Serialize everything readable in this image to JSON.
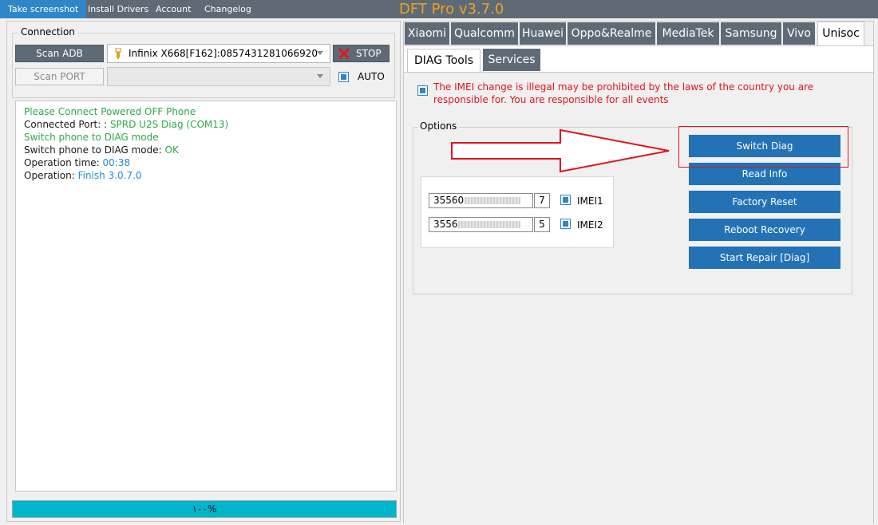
{
  "menu": {
    "items": [
      "Take screenshot",
      "Install Drivers",
      "Account",
      "Changelog"
    ],
    "active_index": 0
  },
  "app_title": "DFT Pro v3.7.0",
  "connection": {
    "legend": "Connection",
    "scan_adb_label": "Scan ADB",
    "scan_port_label": "Scan PORT",
    "device_value": "Infinix X668[F162]:0857431281066920",
    "stop_label": "STOP",
    "auto_label": "AUTO",
    "auto_checked": true
  },
  "log": [
    {
      "parts": [
        {
          "text": "Please Connect Powered OFF Phone",
          "color": "green"
        }
      ]
    },
    {
      "parts": [
        {
          "text": "Connected Port: : ",
          "color": "black"
        },
        {
          "text": "SPRD U2S Diag (COM13)",
          "color": "green"
        }
      ]
    },
    {
      "parts": [
        {
          "text": "Switch phone to DIAG mode",
          "color": "green"
        }
      ]
    },
    {
      "parts": [
        {
          "text": "Switch phone to DIAG mode: ",
          "color": "black"
        },
        {
          "text": "OK",
          "color": "green"
        }
      ]
    },
    {
      "parts": [
        {
          "text": "Operation time: ",
          "color": "black"
        },
        {
          "text": "00:38",
          "color": "blue"
        }
      ]
    },
    {
      "parts": [
        {
          "text": "Operation: ",
          "color": "black"
        },
        {
          "text": "Finish 3.0.7.0",
          "color": "blue"
        }
      ]
    }
  ],
  "progress": {
    "label": "١٠٠%",
    "fraction": 1.0
  },
  "brand_tabs": [
    "Xiaomi",
    "Qualcomm",
    "Huawei",
    "Oppo&Realme",
    "MediaTek",
    "Samsung",
    "Vivo",
    "Unisoc"
  ],
  "brand_active_index": 7,
  "sub_tabs": [
    "DIAG Tools",
    "Services"
  ],
  "sub_active_index": 0,
  "warning": {
    "checked": true,
    "text": "The IMEI change is illegal may be prohibited by the laws of the country you are responsible for. You are responsible for all events"
  },
  "options": {
    "legend": "Options",
    "imei1": {
      "prefix": "35560",
      "check_digit": "7",
      "label": "IMEI1",
      "checked": true
    },
    "imei2": {
      "prefix": "3556",
      "check_digit": "5",
      "label": "IMEI2",
      "checked": true
    }
  },
  "actions": [
    "Switch Diag",
    "Read Info",
    "Factory Reset",
    "Reboot Recovery",
    "Start Repair [Diag]"
  ],
  "colors": {
    "menu_bg": "#5e6b76",
    "menu_active": "#2f86c8",
    "title": "#f0a020",
    "action_button": "#2272b5",
    "warning_text": "#e0141e",
    "highlight": "#e0141e",
    "progress_fill": "#00b4cc",
    "log_green": "#2ea84a",
    "log_blue": "#1f8ed0"
  }
}
